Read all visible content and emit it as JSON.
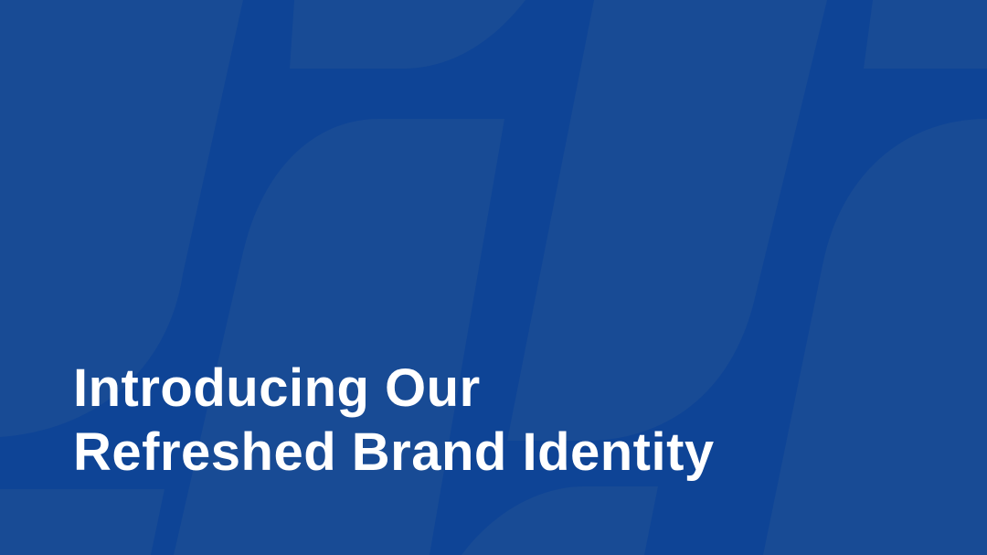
{
  "slide": {
    "title_line_1": "Introducing Our",
    "title_line_2": "Refreshed Brand Identity"
  },
  "colors": {
    "background": "#0e4496",
    "pattern": "#184b95",
    "text": "#ffffff"
  }
}
